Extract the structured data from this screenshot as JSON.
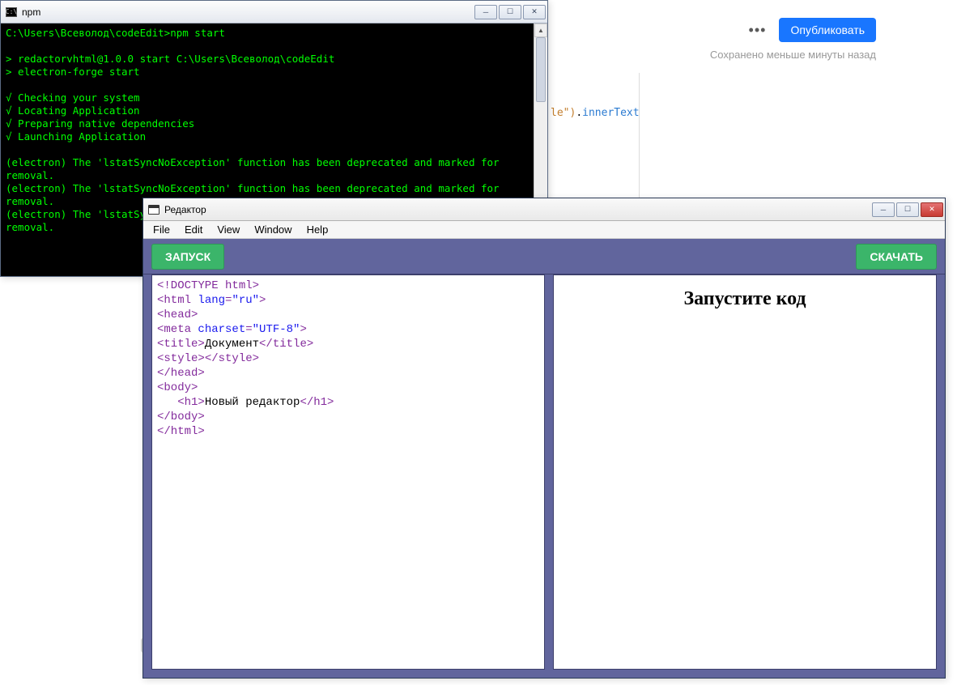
{
  "publish": {
    "dots": "•••",
    "button": "Опубликовать",
    "saved": "Сохранено меньше минуты назад"
  },
  "bgCode": {
    "str": "le\")",
    "dot": ".",
    "prop": "innerText"
  },
  "cmd": {
    "title": "npm",
    "iconGlyph": "C:\\",
    "btnMin": "─",
    "btnMax": "☐",
    "btnClose": "✕",
    "scrollUp": "▲",
    "scrollDown": "▼",
    "lines": "C:\\Users\\Всеволод\\codeEdit>npm start\n\n> redactorvhtml@1.0.0 start C:\\Users\\Всеволод\\codeEdit\n> electron-forge start\n\n√ Checking your system\n√ Locating Application\n√ Preparing native dependencies\n√ Launching Application\n\n(electron) The 'lstatSyncNoException' function has been deprecated and marked for removal.\n(electron) The 'lstatSyncNoException' function has been deprecated and marked for removal.\n(electron) The 'lstatSyncNoException' function has been deprecated and marked for removal."
  },
  "editor": {
    "title": "Редактор",
    "btnMin": "─",
    "btnMax": "☐",
    "btnClose": "✕",
    "menu": [
      "File",
      "Edit",
      "View",
      "Window",
      "Help"
    ],
    "run": "ЗАПУСК",
    "download": "СКАЧАТЬ",
    "previewHeading": "Запустите код",
    "code": {
      "l1a": "<!DOCTYPE html>",
      "l2a": "<html ",
      "l2b": "lang",
      "l2c": "=",
      "l2d": "\"ru\"",
      "l2e": ">",
      "l3": "<head>",
      "l4a": "<meta ",
      "l4b": "charset",
      "l4c": "=",
      "l4d": "\"UTF-8\"",
      "l4e": ">",
      "l5a": "<title>",
      "l5b": "Документ",
      "l5c": "</title>",
      "l6a": "<style>",
      "l6b": "</style>",
      "l7": "</head>",
      "l8": "<body>",
      "l9a": "   <h1>",
      "l9b": "Новый редактор",
      "l9c": "</h1>",
      "l10": "</body>",
      "l11": "</html>"
    }
  }
}
